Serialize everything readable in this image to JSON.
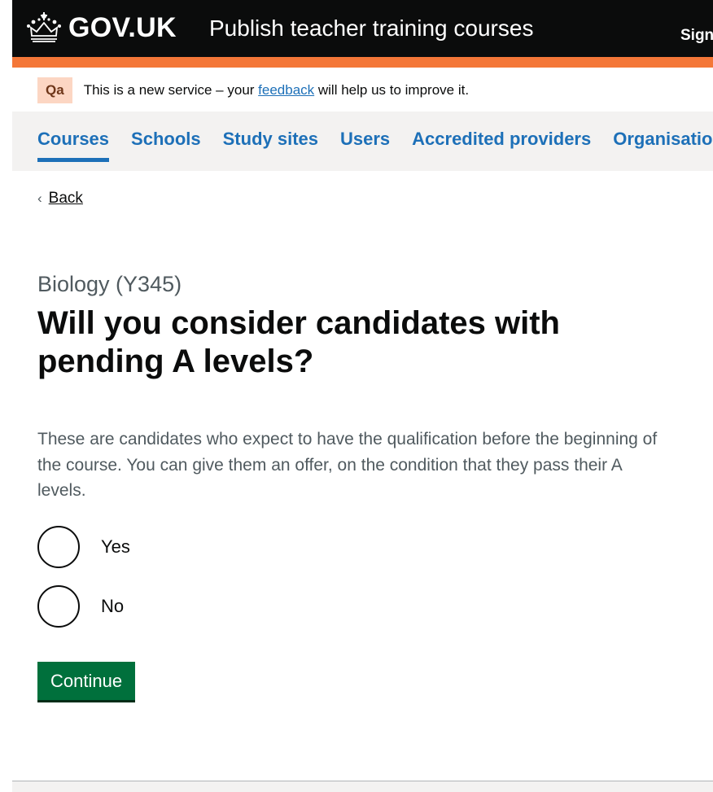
{
  "header": {
    "logo_text": "GOV.UK",
    "service_name": "Publish teacher training courses",
    "signout_label": "Sign out"
  },
  "phase_banner": {
    "tag": "Qa",
    "text_before": "This is a new service – your ",
    "link_text": "feedback",
    "text_after": " will help us to improve it."
  },
  "nav": {
    "items": [
      {
        "label": "Courses"
      },
      {
        "label": "Schools"
      },
      {
        "label": "Study sites"
      },
      {
        "label": "Users"
      },
      {
        "label": "Accredited providers"
      },
      {
        "label": "Organisation details"
      }
    ]
  },
  "back": {
    "label": "Back"
  },
  "main": {
    "caption": "Biology (Y345)",
    "heading": "Will you consider candidates with pending A levels?",
    "hint": "These are candidates who expect to have the qualification before the beginning of the course. You can give them an offer, on the condition that they pass their A levels.",
    "options": [
      {
        "label": "Yes"
      },
      {
        "label": "No"
      }
    ],
    "continue_label": "Continue"
  },
  "colors": {
    "brand_black": "#0b0c0c",
    "header_accent": "#f47738",
    "link_blue": "#1d70b8",
    "button_green": "#00703c",
    "phase_tag_bg": "#fcd6c3"
  }
}
